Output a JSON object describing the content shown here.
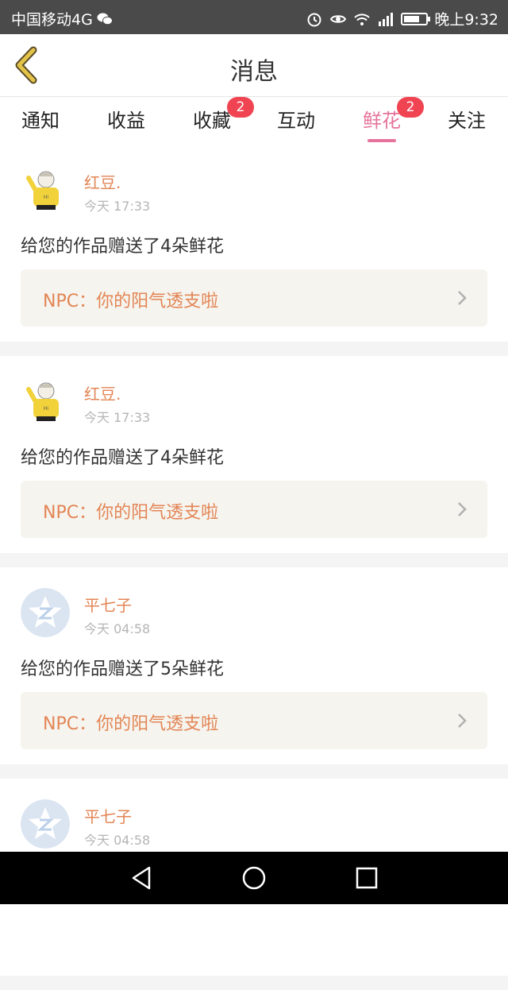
{
  "status": {
    "carrier": "中国移动4G",
    "time": "晚上9:32",
    "battery_level": 0.7
  },
  "header": {
    "title": "消息",
    "back_icon": "chevron-left-icon",
    "back_color": "#d8b53a"
  },
  "tabs": [
    {
      "label": "通知",
      "active": false,
      "badge": ""
    },
    {
      "label": "收益",
      "active": false,
      "badge": ""
    },
    {
      "label": "收藏",
      "active": false,
      "badge": "2"
    },
    {
      "label": "互动",
      "active": false,
      "badge": ""
    },
    {
      "label": "鲜花",
      "active": true,
      "badge": "2"
    },
    {
      "label": "关注",
      "active": false,
      "badge": ""
    }
  ],
  "colors": {
    "accent": "#e5739b",
    "name": "#e38555",
    "badge": "#f04452",
    "quote_bg": "#f5f4ee"
  },
  "messages": [
    {
      "name": "红豆.",
      "time": "今天 17:33",
      "text": "给您的作品赠送了4朵鲜花",
      "quote": "NPC：你的阳气透支啦",
      "avatar": "anime-girl-avatar"
    },
    {
      "name": "红豆.",
      "time": "今天 17:33",
      "text": "给您的作品赠送了4朵鲜花",
      "quote": "NPC：你的阳气透支啦",
      "avatar": "anime-girl-avatar"
    },
    {
      "name": "平七子",
      "time": "今天 04:58",
      "text": "给您的作品赠送了5朵鲜花",
      "quote": "NPC：你的阳气透支啦",
      "avatar": "default-star-avatar"
    },
    {
      "name": "平七子",
      "time": "今天 04:58",
      "text": "",
      "quote": "",
      "avatar": "default-star-avatar"
    }
  ]
}
